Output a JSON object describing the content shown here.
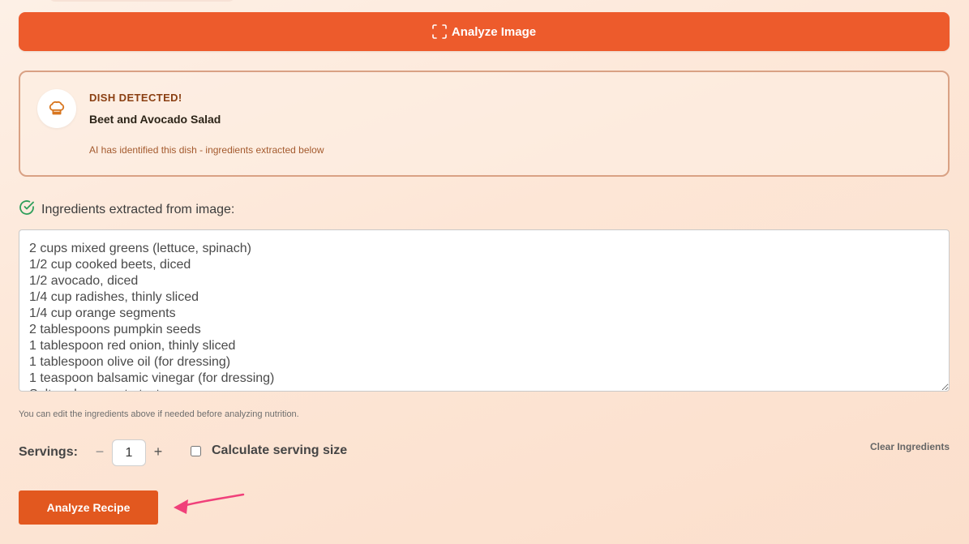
{
  "toolbar": {
    "analyze_image_label": "Analyze Image",
    "analyze_image_icon": "scan-frame-icon"
  },
  "dish": {
    "icon": "chef-hat-icon",
    "label": "DISH DETECTED!",
    "name": "Beet and Avocado Salad",
    "note": "AI has identified this dish - ingredients extracted below"
  },
  "ingredients": {
    "header_icon": "check-circle-icon",
    "header": "Ingredients extracted from image:",
    "text": "2 cups mixed greens (lettuce, spinach)\n1/2 cup cooked beets, diced\n1/2 avocado, diced\n1/4 cup radishes, thinly sliced\n1/4 cup orange segments\n2 tablespoons pumpkin seeds\n1 tablespoon red onion, thinly sliced\n1 tablespoon olive oil (for dressing)\n1 teaspoon balsamic vinegar (for dressing)\nSalt and pepper to taste",
    "edit_hint": "You can edit the ingredients above if needed before analyzing nutrition."
  },
  "servings": {
    "label": "Servings:",
    "minus": "−",
    "plus": "+",
    "value": "1",
    "calc_label": "Calculate serving size",
    "calc_checked": false
  },
  "actions": {
    "clear_label": "Clear Ingredients",
    "analyze_recipe_label": "Analyze Recipe"
  },
  "colors": {
    "accent": "#ed5b2c",
    "annotation_arrow": "#f0407a",
    "success": "#2e9e5a"
  }
}
